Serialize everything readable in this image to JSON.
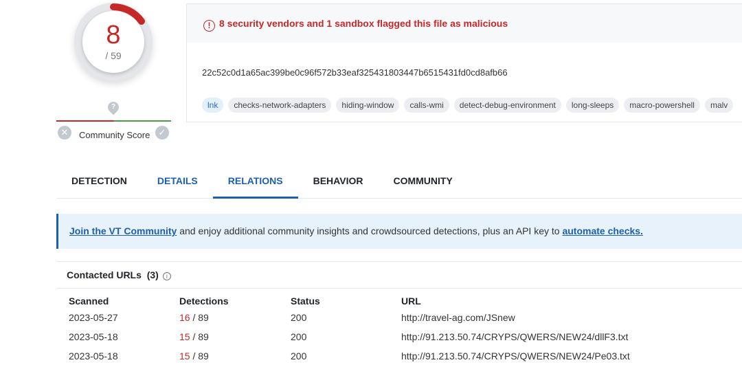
{
  "score": {
    "detected": "8",
    "total": "/ 59",
    "community_label": "Community Score",
    "unknown_icon": "?"
  },
  "alert": {
    "text": "8 security vendors and 1 sandbox flagged this file as malicious",
    "icon": "!"
  },
  "file": {
    "hash": "22c52c0d1a65ac399be0c96f572b33eaf325431803447b6515431fd0cd8afb66"
  },
  "tags": [
    "lnk",
    "checks-network-adapters",
    "hiding-window",
    "calls-wmi",
    "detect-debug-environment",
    "long-sleeps",
    "macro-powershell",
    "malv"
  ],
  "tabs": [
    {
      "label": "DETECTION"
    },
    {
      "label": "DETAILS"
    },
    {
      "label": "RELATIONS"
    },
    {
      "label": "BEHAVIOR"
    },
    {
      "label": "COMMUNITY"
    }
  ],
  "banner": {
    "link1": "Join the VT Community",
    "middle": " and enjoy additional community insights and crowdsourced detections, plus an API key to ",
    "link2": "automate checks."
  },
  "section": {
    "title": "Contacted URLs",
    "count": "(3)",
    "info_icon": "i"
  },
  "table": {
    "headers": [
      "Scanned",
      "Detections",
      "Status",
      "URL"
    ],
    "rows": [
      {
        "scanned": "2023-05-27",
        "det": "16",
        "total": " / 89",
        "status": "200",
        "url": "http://travel-ag.com/JSnew"
      },
      {
        "scanned": "2023-05-18",
        "det": "15",
        "total": " / 89",
        "status": "200",
        "url": "http://91.213.50.74/CRYPS/QWERS/NEW24/dllF3.txt"
      },
      {
        "scanned": "2023-05-18",
        "det": "15",
        "total": " / 89",
        "status": "200",
        "url": "http://91.213.50.74/CRYPS/QWERS/NEW24/Pe03.txt"
      }
    ]
  },
  "colors": {
    "malicious": "#c62828",
    "accent": "#1c5fb0",
    "harmless": "#43a047"
  }
}
